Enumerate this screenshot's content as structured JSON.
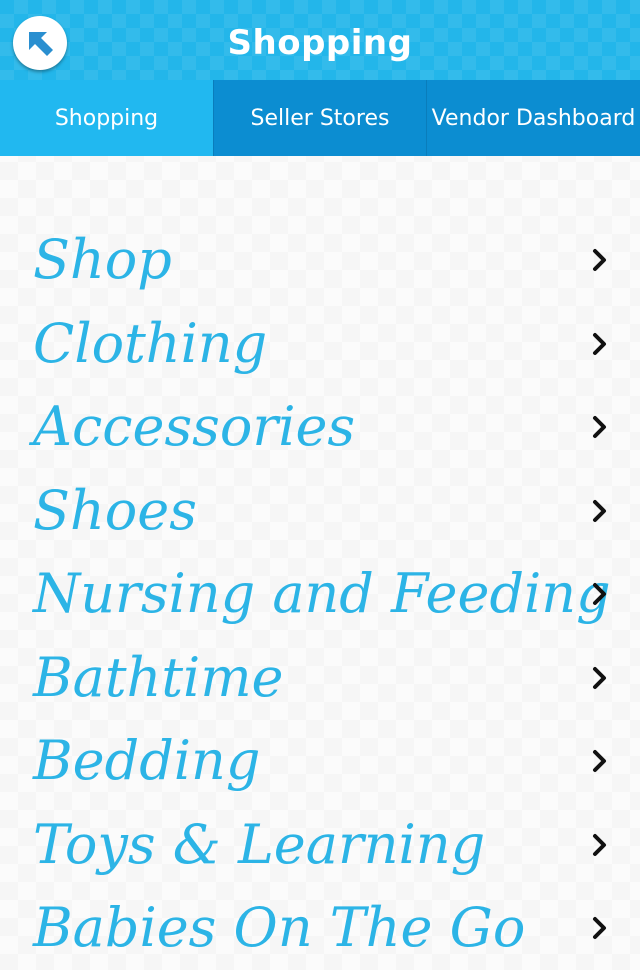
{
  "header": {
    "title": "Shopping"
  },
  "icons": {
    "back": "back-arrow-icon",
    "chevron": "chevron-right-icon"
  },
  "colors": {
    "header_blue": "#23b6ea",
    "active_tab": "#21b8f0",
    "inactive_tab": "#0c8dd1",
    "item_text": "#2cb4e6"
  },
  "tabs": [
    {
      "label": "Shopping",
      "active": true
    },
    {
      "label": "Seller Stores",
      "active": false
    },
    {
      "label": "Vendor Dashboard",
      "active": false
    }
  ],
  "categories": [
    {
      "label": "Shop"
    },
    {
      "label": "Clothing"
    },
    {
      "label": "Accessories"
    },
    {
      "label": "Shoes"
    },
    {
      "label": "Nursing and Feeding"
    },
    {
      "label": "Bathtime"
    },
    {
      "label": "Bedding"
    },
    {
      "label": "Toys & Learning"
    },
    {
      "label": "Babies On The Go"
    }
  ]
}
